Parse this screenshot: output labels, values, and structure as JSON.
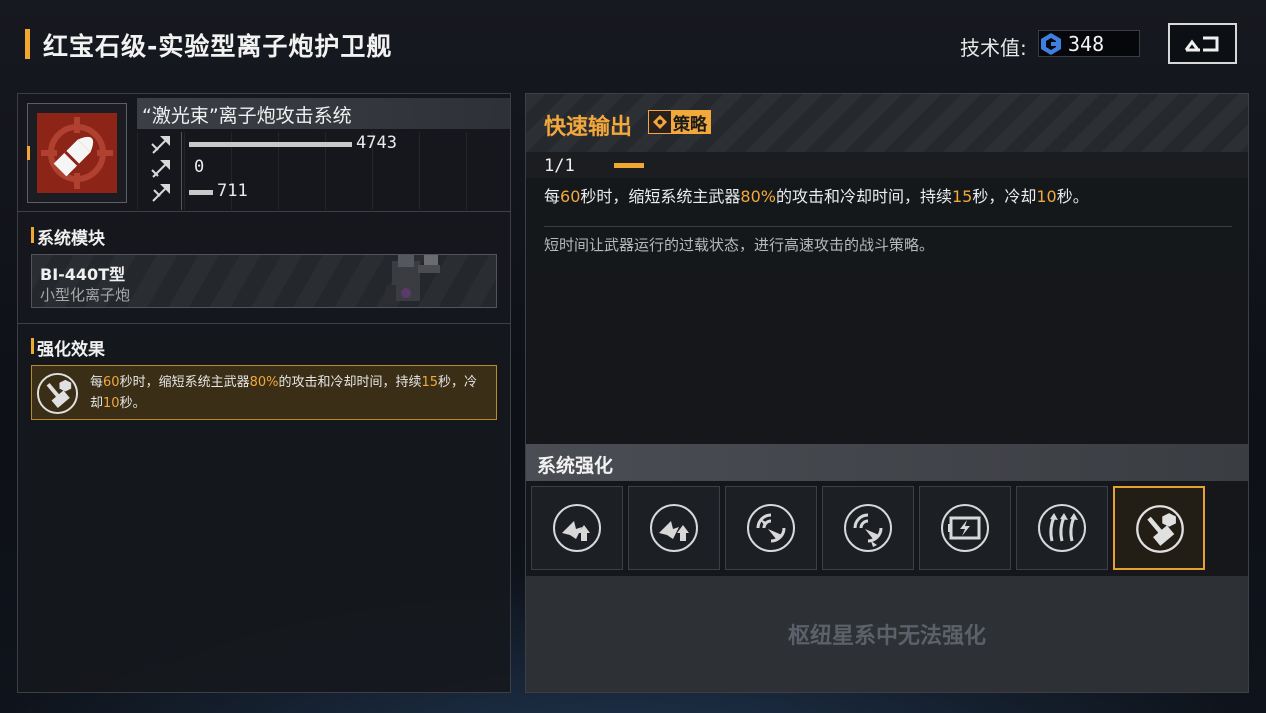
{
  "header": {
    "title": "红宝石级-实验型离子炮护卫舰",
    "tech_label": "技术值:",
    "tech_value": "348",
    "tech_icon": "tech-hex-icon",
    "back_icon": "back-arrow-icon"
  },
  "weapon": {
    "name": "“激光束”离子炮攻击系统",
    "tile_color": "#8c2418",
    "icon": "crosshair-shell-icon",
    "stats": [
      {
        "icon": "anti-ship-arrow-icon",
        "value": "4743",
        "fill": 1.0
      },
      {
        "icon": "anti-fighter-arrow-icon",
        "value": "0",
        "fill": 0.0
      },
      {
        "icon": "siege-arrow-icon",
        "value": "711",
        "fill": 0.15
      }
    ]
  },
  "system_module": {
    "title": "系统模块",
    "model": "BI-440T型",
    "subtitle": "小型化离子炮"
  },
  "enhancement_effect": {
    "title": "强化效果",
    "segments": [
      "每",
      "60",
      "秒时，缩短系统主武器",
      "80%",
      "的攻击和冷却时间，持续",
      "15",
      "秒，冷却",
      "10",
      "秒。"
    ]
  },
  "skill": {
    "name": "快速输出",
    "tag": "策略",
    "level": "1/1",
    "description": [
      "每",
      "60",
      "秒时，缩短系统主武器",
      "80%",
      "的攻击和冷却时间，持续",
      "15",
      "秒，冷却",
      "10",
      "秒。"
    ],
    "flavor": "短时间让武器运行的过载状态，进行高速攻击的战斗策略。"
  },
  "system_enhance": {
    "title": "系统强化",
    "slots": [
      {
        "icon": "arrows-up-fighter-icon"
      },
      {
        "icon": "arrows-up-fighter-alt-icon"
      },
      {
        "icon": "radar-sweep-icon"
      },
      {
        "icon": "radar-sweep-alt-icon"
      },
      {
        "icon": "energy-battery-icon"
      },
      {
        "icon": "triple-arrow-up-icon"
      },
      {
        "icon": "turret-boost-icon",
        "selected": true
      }
    ],
    "locked_text": "枢纽星系中无法强化"
  },
  "colors": {
    "accent": "#f0a830",
    "highlight": "#f2a83a"
  }
}
